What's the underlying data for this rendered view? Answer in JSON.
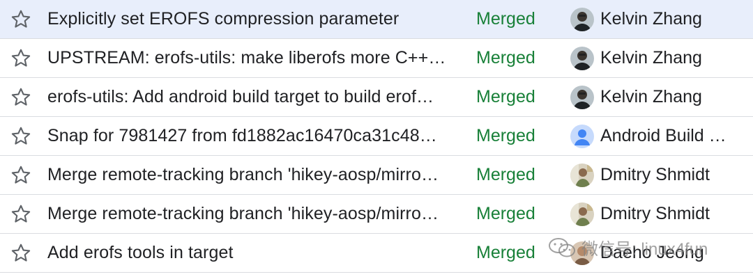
{
  "changes": [
    {
      "subject": "Explicitly set EROFS compression parameter",
      "status": "Merged",
      "owner": "Kelvin Zhang",
      "avatar_icon": "person-photo-icon"
    },
    {
      "subject": "UPSTREAM: erofs-utils: make liberofs more C++…",
      "status": "Merged",
      "owner": "Kelvin Zhang",
      "avatar_icon": "person-photo-icon"
    },
    {
      "subject": "erofs-utils: Add android build target to build erof…",
      "status": "Merged",
      "owner": "Kelvin Zhang",
      "avatar_icon": "person-photo-icon"
    },
    {
      "subject": "Snap for 7981427 from fd1882ac16470ca31c48…",
      "status": "Merged",
      "owner": "Android Build …",
      "avatar_icon": "default-user-icon"
    },
    {
      "subject": "Merge remote-tracking branch 'hikey-aosp/mirro…",
      "status": "Merged",
      "owner": "Dmitry Shmidt",
      "avatar_icon": "person-photo-icon"
    },
    {
      "subject": "Merge remote-tracking branch 'hikey-aosp/mirro…",
      "status": "Merged",
      "owner": "Dmitry Shmidt",
      "avatar_icon": "person-photo-icon"
    },
    {
      "subject": "Add erofs tools in target",
      "status": "Merged",
      "owner": "Daeho Jeong",
      "avatar_icon": "person-photo-icon"
    }
  ],
  "watermark": "微信号: linux4fun",
  "colors": {
    "merged": "#188038",
    "selected_row": "#e8eefb",
    "divider": "#dadce0"
  }
}
